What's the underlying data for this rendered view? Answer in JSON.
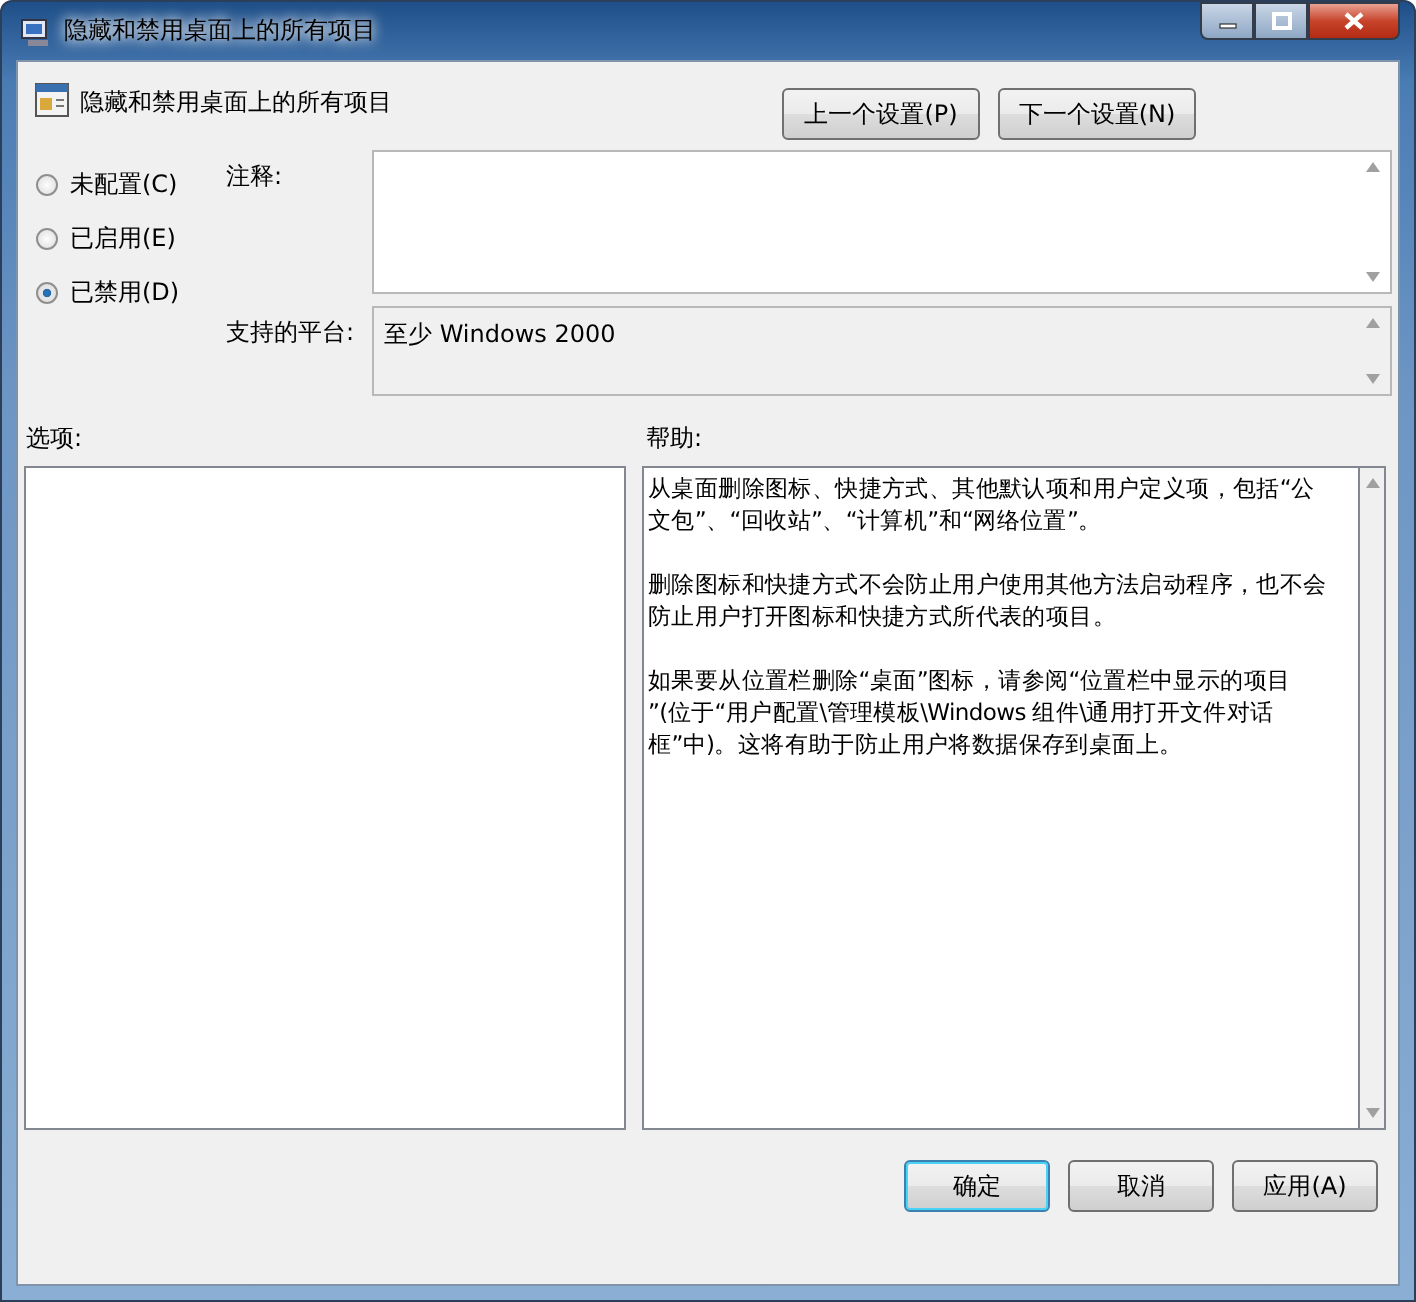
{
  "window": {
    "title": "隐藏和禁用桌面上的所有项目"
  },
  "header": {
    "title": "隐藏和禁用桌面上的所有项目"
  },
  "nav_buttons": [
    "上一个设置(P)",
    "下一个设置(N)"
  ],
  "state_options": [
    {
      "label": "未配置(C)",
      "selected": false
    },
    {
      "label": "已启用(E)",
      "selected": false
    },
    {
      "label": "已禁用(D)",
      "selected": true
    }
  ],
  "comment": {
    "label": "注释:"
  },
  "platform": {
    "label": "支持的平台:",
    "value": "至少 Windows 2000"
  },
  "options": {
    "label": "选项:"
  },
  "help": {
    "label": "帮助:",
    "paragraphs": [
      {
        "lines": [
          "从桌面删除图标、快捷方式、其他默认项和用户定义项，包括“公",
          "文包”、“回收站”、“计算机”和“网络位置”。"
        ]
      },
      {
        "lines": [
          "删除图标和快捷方式不会防止用户使用其他方法启动程序，也不会",
          "防止用户打开图标和快捷方式所代表的项目。"
        ]
      },
      {
        "lines": [
          "如果要从位置栏删除“桌面”图标，请参阅“位置栏中显示的项目",
          "”(位于“用户配置\\管理模板\\Windows 组件\\通用打开文件对话",
          "框”中)。这将有助于防止用户将数据保存到桌面上。"
        ]
      }
    ]
  },
  "buttons": [
    {
      "label": "确定",
      "default": true
    },
    {
      "label": "取消",
      "default": false
    },
    {
      "label": "应用(A)",
      "default": false
    }
  ]
}
